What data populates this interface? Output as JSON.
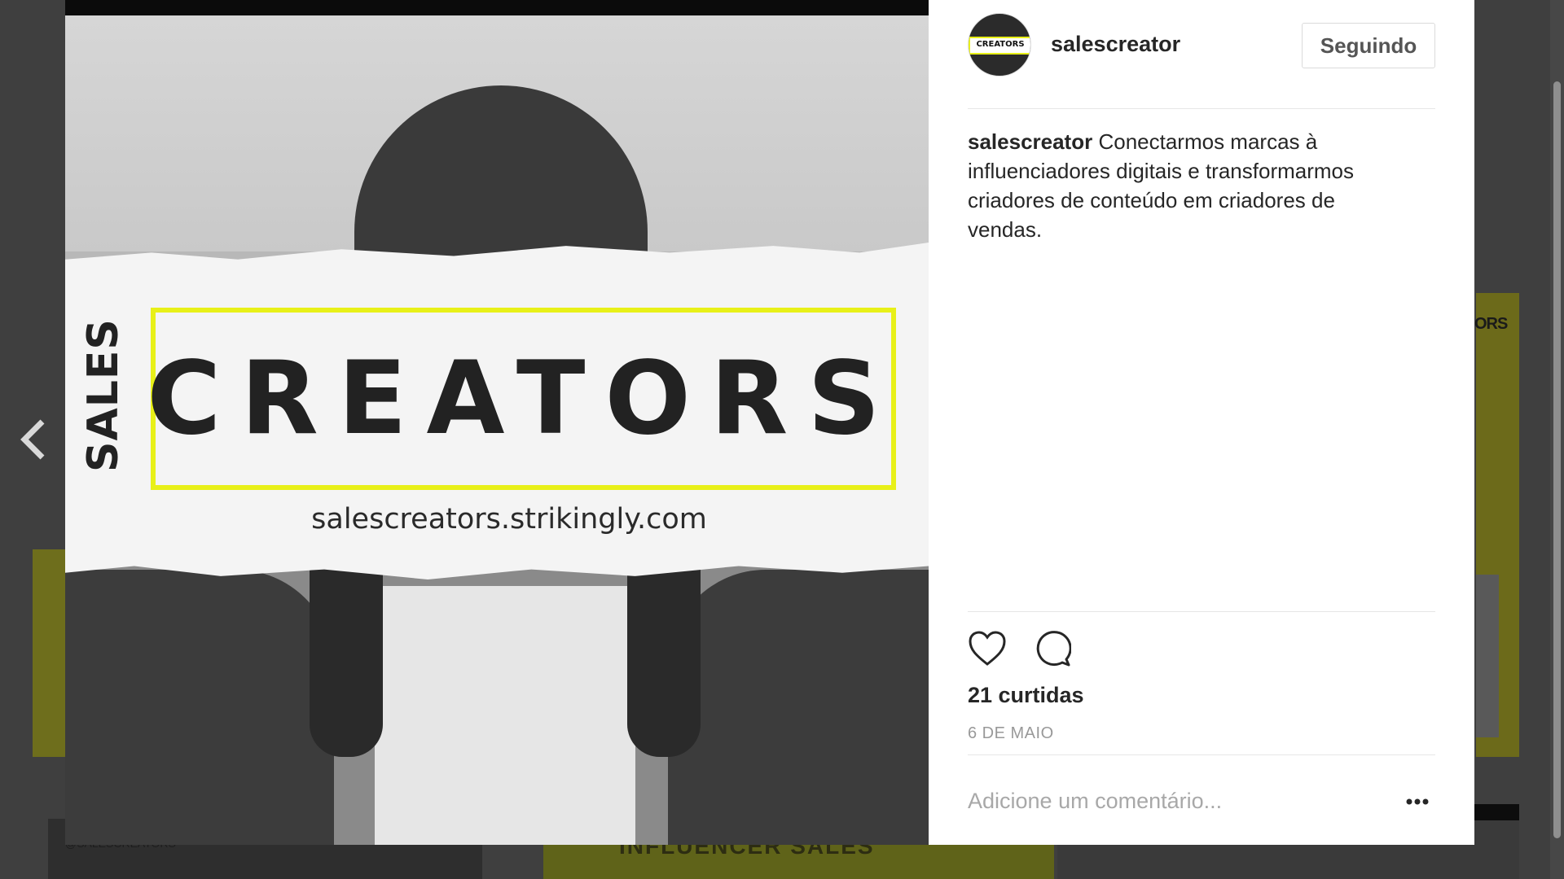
{
  "background": {
    "right_tile_text": "ORS",
    "bottom_handle": "@SALESCREATORS",
    "bottom_tile_text": "INFLUENCER SALES"
  },
  "navigation": {
    "prev_icon": "chevron-left-icon"
  },
  "post_image": {
    "side_word": "SALES",
    "brand_word": "CREATORS",
    "url": "salescreators.strikingly.com",
    "accent_color": "#e8f018"
  },
  "header": {
    "avatar_text": "CREATORS",
    "username": "salescreator",
    "follow_label": "Seguindo"
  },
  "caption": {
    "username": "salescreator",
    "text": "Conectarmos marcas à influenciadores digitais e transformarmos criadores de conteúdo em criadores de vendas."
  },
  "actions": {
    "like_icon": "heart-icon",
    "comment_icon": "comment-bubble-icon",
    "likes": "21 curtidas",
    "date": "6 DE MAIO"
  },
  "comment": {
    "placeholder": "Adicione um comentário...",
    "more_icon": "more-options-icon"
  }
}
